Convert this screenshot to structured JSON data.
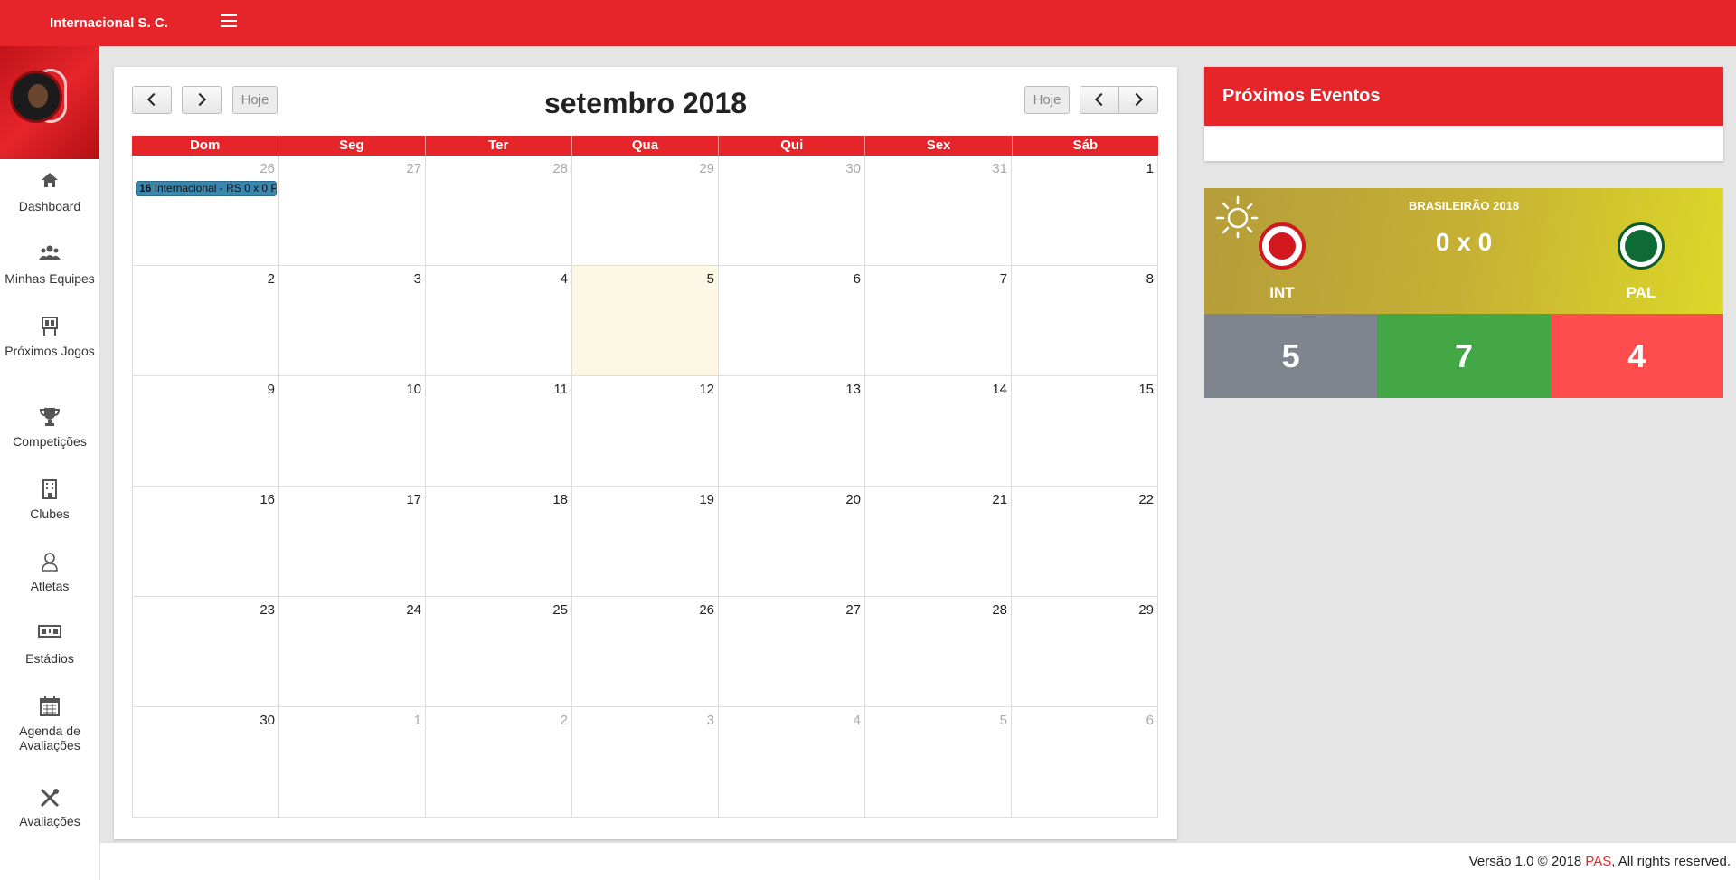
{
  "app": {
    "brand": "Internacional S. C.",
    "accent": "#e5252a"
  },
  "sidebar": {
    "items": [
      {
        "label": "Dashboard",
        "icon": "home-icon"
      },
      {
        "label": "Minhas Equipes",
        "icon": "users-icon"
      },
      {
        "label": "Próximos Jogos",
        "icon": "board-icon"
      },
      {
        "label": "Competições",
        "icon": "trophy-icon"
      },
      {
        "label": "Clubes",
        "icon": "building-icon"
      },
      {
        "label": "Atletas",
        "icon": "user-icon"
      },
      {
        "label": "Estádios",
        "icon": "scoreboard-icon"
      },
      {
        "label": "Agenda de Avaliações",
        "icon": "calendar-icon"
      },
      {
        "label": "Avaliações",
        "icon": "tools-icon"
      }
    ]
  },
  "calendar": {
    "title": "setembro 2018",
    "today_label": "Hoje",
    "weekdays": [
      "Dom",
      "Seg",
      "Ter",
      "Qua",
      "Qui",
      "Sex",
      "Sáb"
    ],
    "weeks": [
      [
        "26",
        "27",
        "28",
        "29",
        "30",
        "31",
        "1"
      ],
      [
        "2",
        "3",
        "4",
        "5",
        "6",
        "7",
        "8"
      ],
      [
        "9",
        "10",
        "11",
        "12",
        "13",
        "14",
        "15"
      ],
      [
        "16",
        "17",
        "18",
        "19",
        "20",
        "21",
        "22"
      ],
      [
        "23",
        "24",
        "25",
        "26",
        "27",
        "28",
        "29"
      ],
      [
        "30",
        "1",
        "2",
        "3",
        "4",
        "5",
        "6"
      ]
    ],
    "event": {
      "time": "16",
      "text": " Internacional - RS 0 x 0 P"
    }
  },
  "events_panel": {
    "title": "Próximos Eventos"
  },
  "match": {
    "competition": "BRASILEIRÃO 2018",
    "score": "0 x 0",
    "home": "INT",
    "away": "PAL",
    "stats": [
      {
        "value": "5",
        "color": "#7f858e"
      },
      {
        "value": "7",
        "color": "#43a746"
      },
      {
        "value": "4",
        "color": "#ff4c4c"
      }
    ]
  },
  "footer": {
    "prefix": "Versão 1.0 © 2018 ",
    "link": "PAS",
    "suffix": ", All rights reserved."
  }
}
